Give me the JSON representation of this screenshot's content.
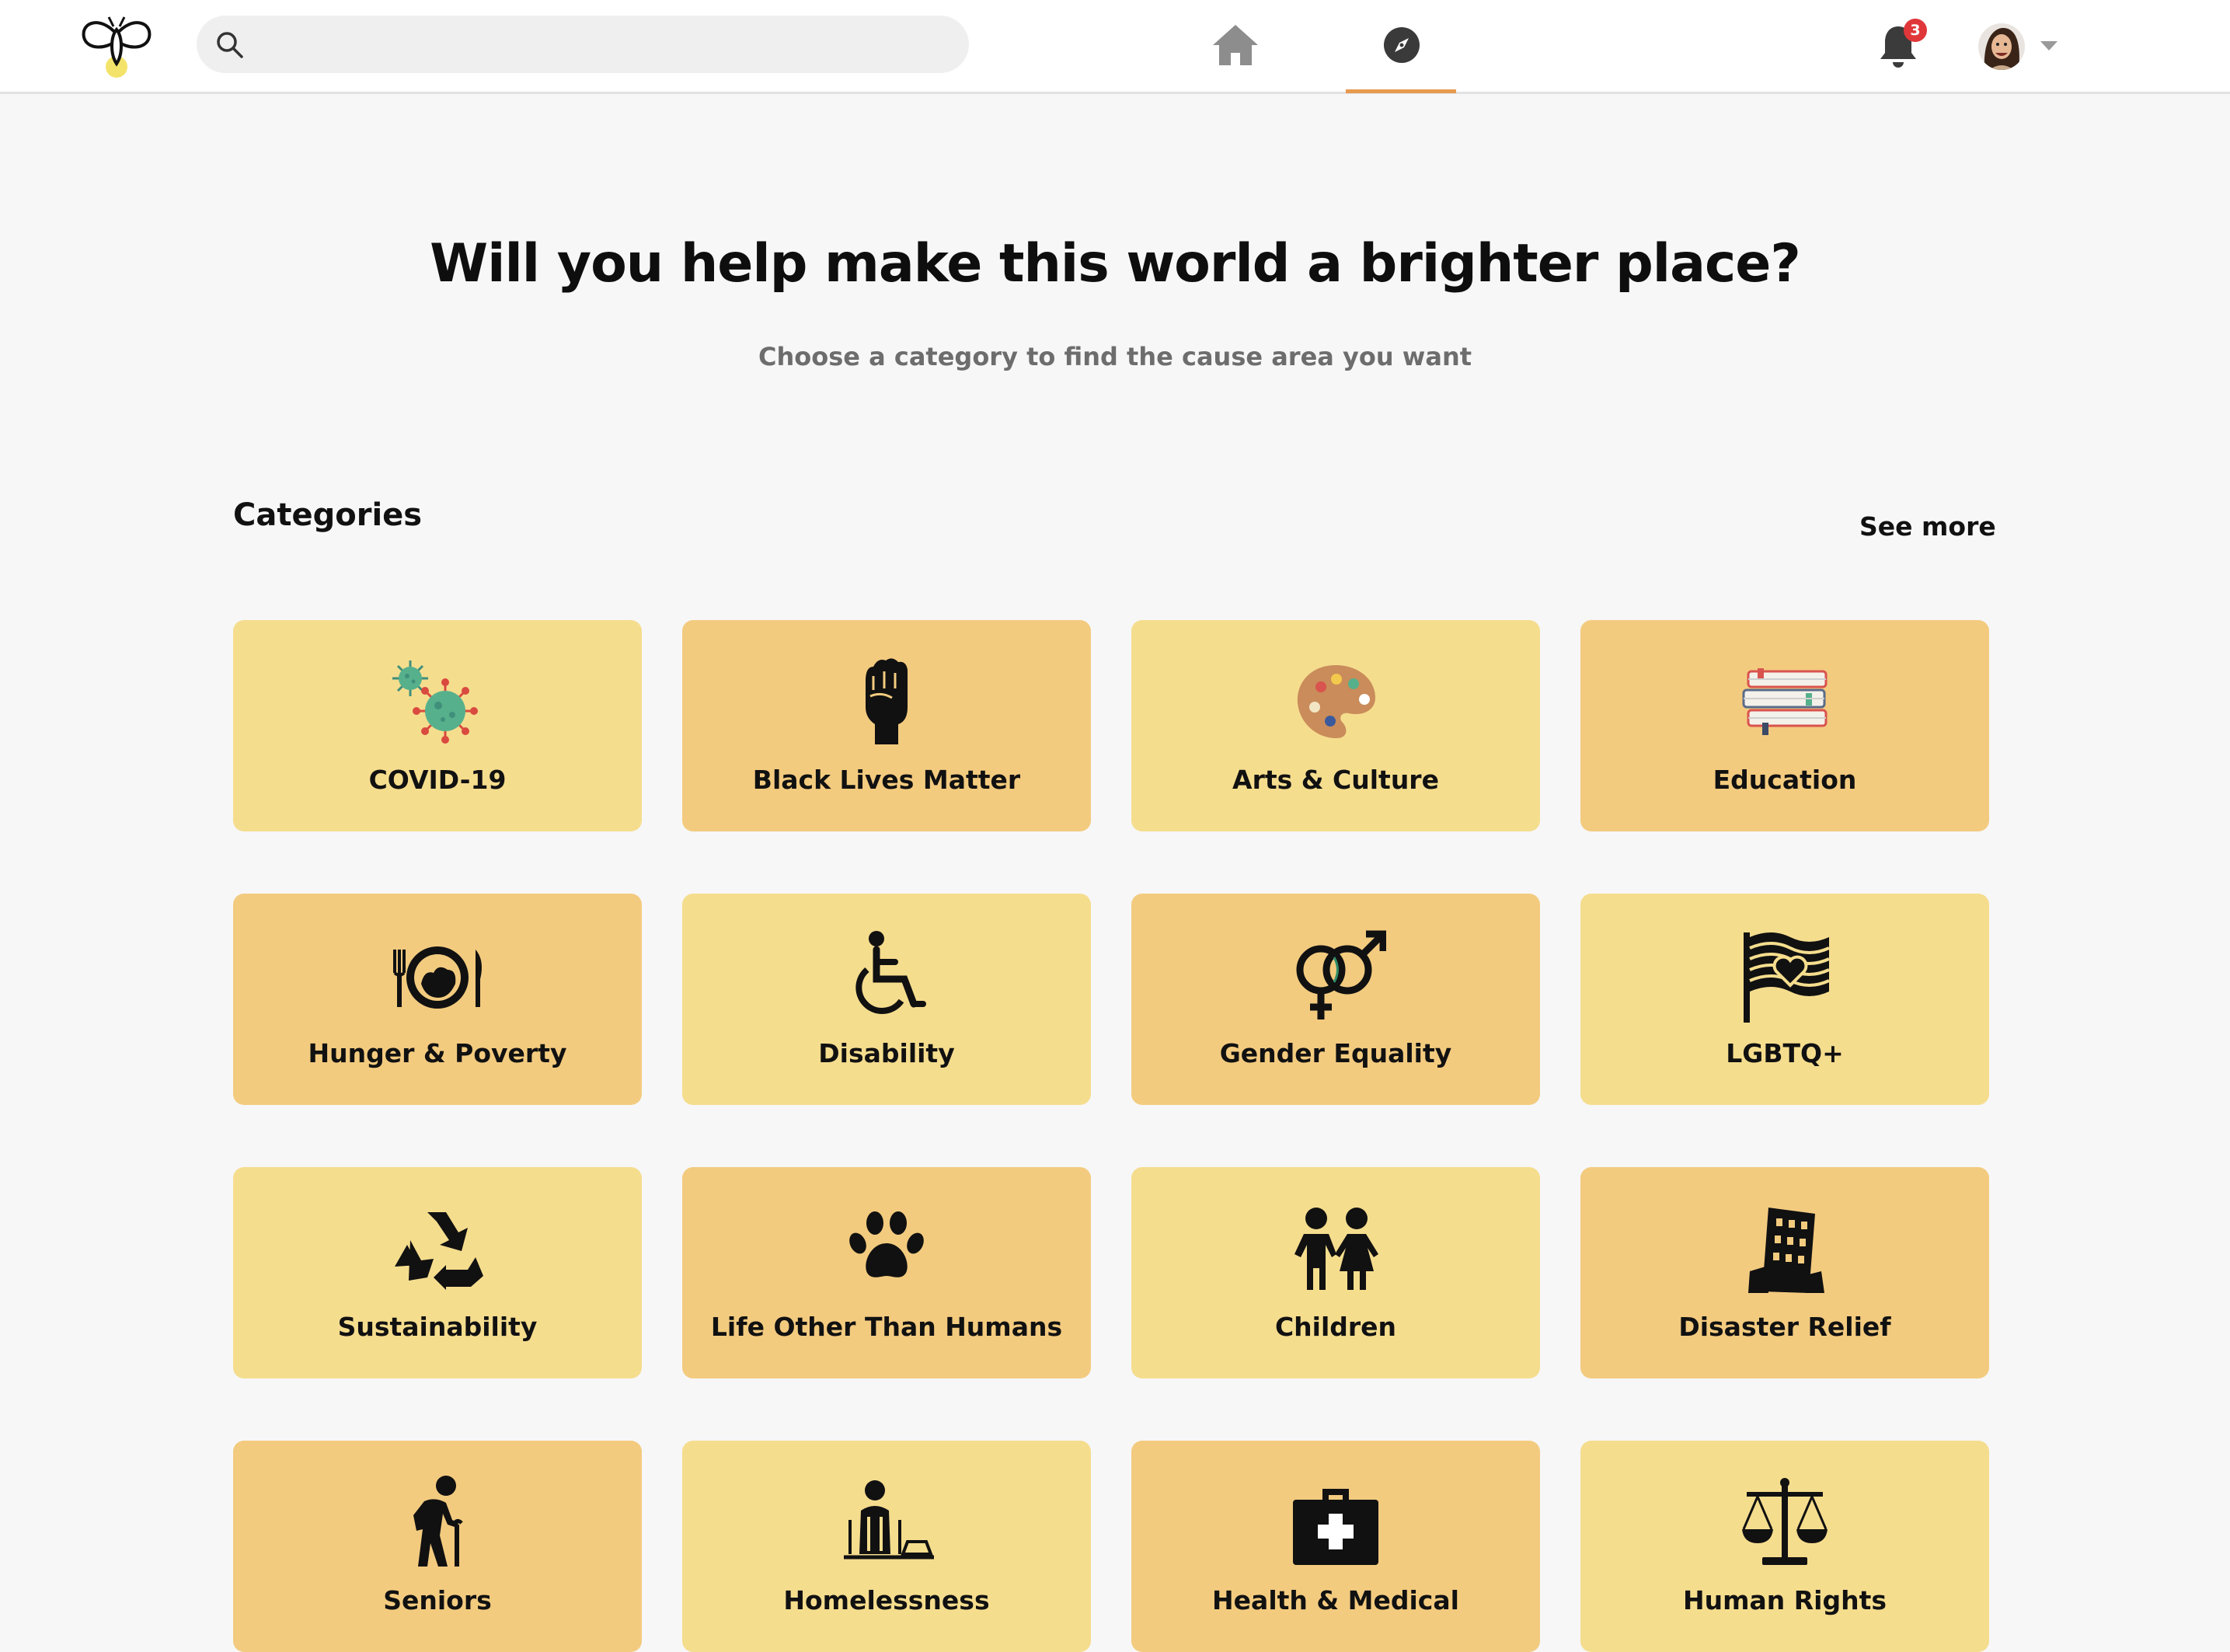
{
  "header": {
    "search_placeholder": "",
    "notification_count": "3",
    "accent_color": "#e89a4f"
  },
  "hero": {
    "title": "Will you help make this world a brighter place?",
    "subtitle": "Choose a category to find the cause area you want"
  },
  "categories": {
    "heading": "Categories",
    "see_more": "See more",
    "items": [
      {
        "label": "COVID-19",
        "icon": "virus-icon"
      },
      {
        "label": "Black Lives Matter",
        "icon": "raised-fist-icon"
      },
      {
        "label": "Arts & Culture",
        "icon": "paint-palette-icon"
      },
      {
        "label": "Education",
        "icon": "books-icon"
      },
      {
        "label": "Hunger & Poverty",
        "icon": "plate-cutlery-icon"
      },
      {
        "label": "Disability",
        "icon": "wheelchair-icon"
      },
      {
        "label": "Gender Equality",
        "icon": "gender-symbols-icon"
      },
      {
        "label": "LGBTQ+",
        "icon": "heart-flag-icon"
      },
      {
        "label": "Sustainability",
        "icon": "recycle-icon"
      },
      {
        "label": "Life Other Than Humans",
        "icon": "paw-icon"
      },
      {
        "label": "Children",
        "icon": "children-icon"
      },
      {
        "label": "Disaster Relief",
        "icon": "collapsing-building-icon"
      },
      {
        "label": "Seniors",
        "icon": "elderly-person-icon"
      },
      {
        "label": "Homelessness",
        "icon": "homeless-person-icon"
      },
      {
        "label": "Health & Medical",
        "icon": "first-aid-kit-icon"
      },
      {
        "label": "Human Rights",
        "icon": "scales-icon"
      }
    ]
  },
  "colors": {
    "card_light": "#f5dd8e",
    "card_dark": "#f3cb7f",
    "background": "#f7f7f7"
  }
}
